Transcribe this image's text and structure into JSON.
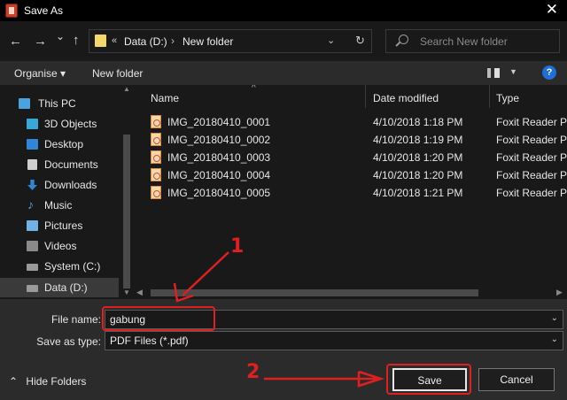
{
  "window": {
    "title": "Save As",
    "close_glyph": "✕"
  },
  "nav": {
    "back_glyph": "←",
    "forward_glyph": "→",
    "recent_glyph": "⌄",
    "up_glyph": "↑",
    "address": {
      "overflow": "«",
      "crumbs": [
        "Data (D:)",
        "New folder"
      ],
      "separator": "›"
    },
    "search_placeholder": "Search New folder"
  },
  "toolbar": {
    "organise": "Organise ▾",
    "new_folder": "New folder",
    "help": "?"
  },
  "sidebar": {
    "items": [
      {
        "label": "This PC",
        "icon": "pc-icon",
        "color": "#4aa3df"
      },
      {
        "label": "3D Objects",
        "icon": "cube-icon",
        "color": "#39a7d8"
      },
      {
        "label": "Desktop",
        "icon": "desktop-icon",
        "color": "#2f86d6"
      },
      {
        "label": "Documents",
        "icon": "document-icon",
        "color": "#cfcfcf"
      },
      {
        "label": "Downloads",
        "icon": "download-icon",
        "color": "#2f86d6"
      },
      {
        "label": "Music",
        "icon": "music-icon",
        "color": "#5aa0e0"
      },
      {
        "label": "Pictures",
        "icon": "pictures-icon",
        "color": "#6fb3e6"
      },
      {
        "label": "Videos",
        "icon": "videos-icon",
        "color": "#8a8a8a"
      },
      {
        "label": "System (C:)",
        "icon": "drive-icon",
        "color": "#9a9a9a"
      },
      {
        "label": "Data (D:)",
        "icon": "drive-icon",
        "color": "#9a9a9a"
      }
    ],
    "selected_index": 9
  },
  "filelist": {
    "columns": [
      "Name",
      "Date modified",
      "Type"
    ],
    "rows": [
      {
        "name": "IMG_20180410_0001",
        "date": "4/10/2018 1:18 PM",
        "type": "Foxit Reader PDF"
      },
      {
        "name": "IMG_20180410_0002",
        "date": "4/10/2018 1:19 PM",
        "type": "Foxit Reader PDF"
      },
      {
        "name": "IMG_20180410_0003",
        "date": "4/10/2018 1:20 PM",
        "type": "Foxit Reader PDF"
      },
      {
        "name": "IMG_20180410_0004",
        "date": "4/10/2018 1:20 PM",
        "type": "Foxit Reader PDF"
      },
      {
        "name": "IMG_20180410_0005",
        "date": "4/10/2018 1:21 PM",
        "type": "Foxit Reader PDF"
      }
    ]
  },
  "form": {
    "filename_label": "File name:",
    "filename_value": "gabung",
    "savetype_label": "Save as type:",
    "savetype_value": "PDF Files (*.pdf)",
    "hide_folders": "Hide Folders",
    "save_button": "Save",
    "cancel_button": "Cancel"
  },
  "annotations": {
    "label_1": "1",
    "label_2": "2",
    "color": "#e02020"
  }
}
